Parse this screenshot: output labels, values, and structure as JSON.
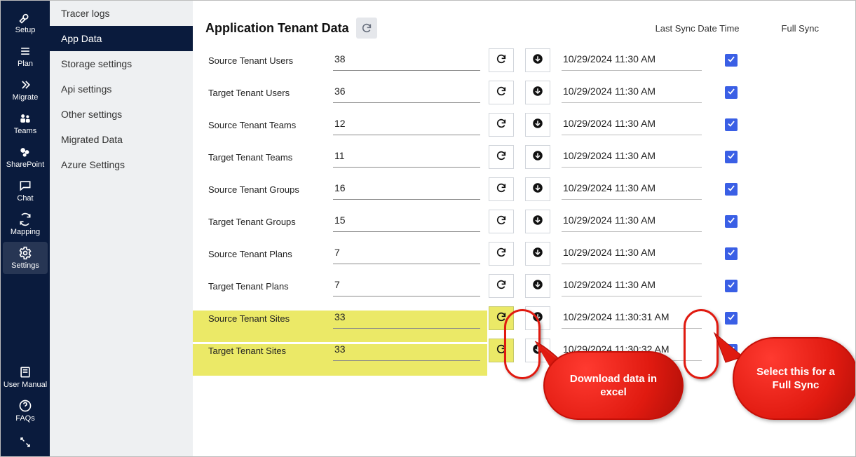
{
  "rail": {
    "items": [
      {
        "label": "Setup"
      },
      {
        "label": "Plan"
      },
      {
        "label": "Migrate"
      },
      {
        "label": "Teams"
      },
      {
        "label": "SharePoint"
      },
      {
        "label": "Chat"
      },
      {
        "label": "Mapping"
      },
      {
        "label": "Settings"
      }
    ],
    "bottom": [
      {
        "label": "User Manual"
      },
      {
        "label": "FAQs"
      }
    ]
  },
  "subnav": {
    "items": [
      {
        "label": "Tracer logs"
      },
      {
        "label": "App Data"
      },
      {
        "label": "Storage settings"
      },
      {
        "label": "Api settings"
      },
      {
        "label": "Other settings"
      },
      {
        "label": "Migrated Data"
      },
      {
        "label": "Azure Settings"
      }
    ],
    "active_index": 1
  },
  "main": {
    "title": "Application Tenant Data",
    "header": {
      "last_sync_label": "Last Sync Date Time",
      "full_sync_label": "Full Sync"
    },
    "rows": [
      {
        "label": "Source Tenant Users",
        "value": "38",
        "time": "10/29/2024 11:30 AM",
        "checked": true,
        "hl": false
      },
      {
        "label": "Target Tenant Users",
        "value": "36",
        "time": "10/29/2024 11:30 AM",
        "checked": true,
        "hl": false
      },
      {
        "label": "Source Tenant Teams",
        "value": "12",
        "time": "10/29/2024 11:30 AM",
        "checked": true,
        "hl": false
      },
      {
        "label": "Target Tenant Teams",
        "value": "11",
        "time": "10/29/2024 11:30 AM",
        "checked": true,
        "hl": false
      },
      {
        "label": "Source Tenant Groups",
        "value": "16",
        "time": "10/29/2024 11:30 AM",
        "checked": true,
        "hl": false
      },
      {
        "label": "Target Tenant Groups",
        "value": "15",
        "time": "10/29/2024 11:30 AM",
        "checked": true,
        "hl": false
      },
      {
        "label": "Source Tenant Plans",
        "value": "7",
        "time": "10/29/2024 11:30 AM",
        "checked": true,
        "hl": false
      },
      {
        "label": "Target Tenant Plans",
        "value": "7",
        "time": "10/29/2024 11:30 AM",
        "checked": true,
        "hl": false
      },
      {
        "label": "Source Tenant Sites",
        "value": "33",
        "time": "10/29/2024 11:30:31 AM",
        "checked": true,
        "hl": true
      },
      {
        "label": "Target Tenant Sites",
        "value": "33",
        "time": "10/29/2024 11:30:32 AM",
        "checked": true,
        "hl": true
      }
    ]
  },
  "callouts": {
    "download": "Download data in excel",
    "fullsync": "Select this for a Full Sync"
  }
}
